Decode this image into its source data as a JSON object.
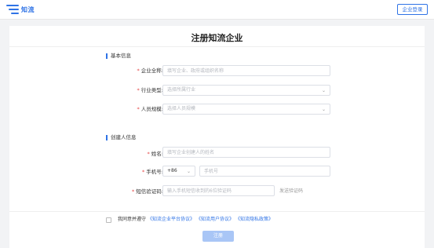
{
  "header": {
    "brand": "知流",
    "login_label": "企业登录"
  },
  "page": {
    "title": "注册知流企业"
  },
  "basic_info": {
    "heading": "基本信息",
    "company_name": {
      "label": "企业全称:",
      "placeholder": "填写企业、政府或组织名称"
    },
    "industry": {
      "label": "行业类型:",
      "placeholder": "选择所属行业"
    },
    "staff_size": {
      "label": "人员规模:",
      "placeholder": "选择人员规模"
    }
  },
  "creator_info": {
    "heading": "创建人信息",
    "name": {
      "label": "姓名:",
      "placeholder": "填写企业创建人的姓名"
    },
    "phone": {
      "label": "手机号:",
      "prefix": "+86",
      "placeholder": "手机号"
    },
    "sms_code": {
      "label": "短信验证码:",
      "placeholder": "输入手机短信收到的6位验证码",
      "send_label": "发送验证码"
    }
  },
  "agreement": {
    "text": "我同意并遵守",
    "links": [
      "《知流企业平台协议》",
      "《知流用户协议》",
      "《知流隐私政策》"
    ]
  },
  "submit": {
    "label": "注册"
  }
}
